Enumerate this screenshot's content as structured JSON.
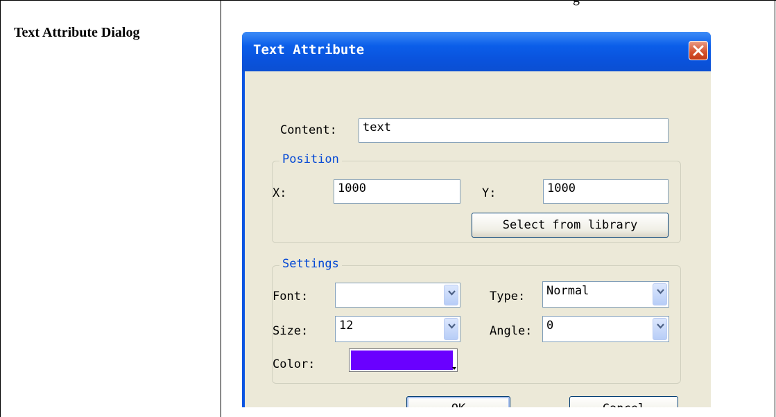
{
  "document": {
    "top_fragment": "g",
    "cell_label": "Text Attribute Dialog"
  },
  "dialog": {
    "title": "Text Attribute",
    "close_icon": "close-x-icon",
    "content": {
      "label": "Content:",
      "value": "text"
    },
    "position": {
      "legend": "Position",
      "x_label": "X:",
      "x_value": "1000",
      "y_label": "Y:",
      "y_value": "1000",
      "library_button": "Select from library"
    },
    "settings": {
      "legend": "Settings",
      "font_label": "Font:",
      "font_value": "",
      "type_label": "Type:",
      "type_value": "Normal",
      "size_label": "Size:",
      "size_value": "12",
      "angle_label": "Angle:",
      "angle_value": "0",
      "color_label": "Color:",
      "color_value": "#6a00ff"
    },
    "ok_button": "OK",
    "cancel_button": "Cancel"
  }
}
